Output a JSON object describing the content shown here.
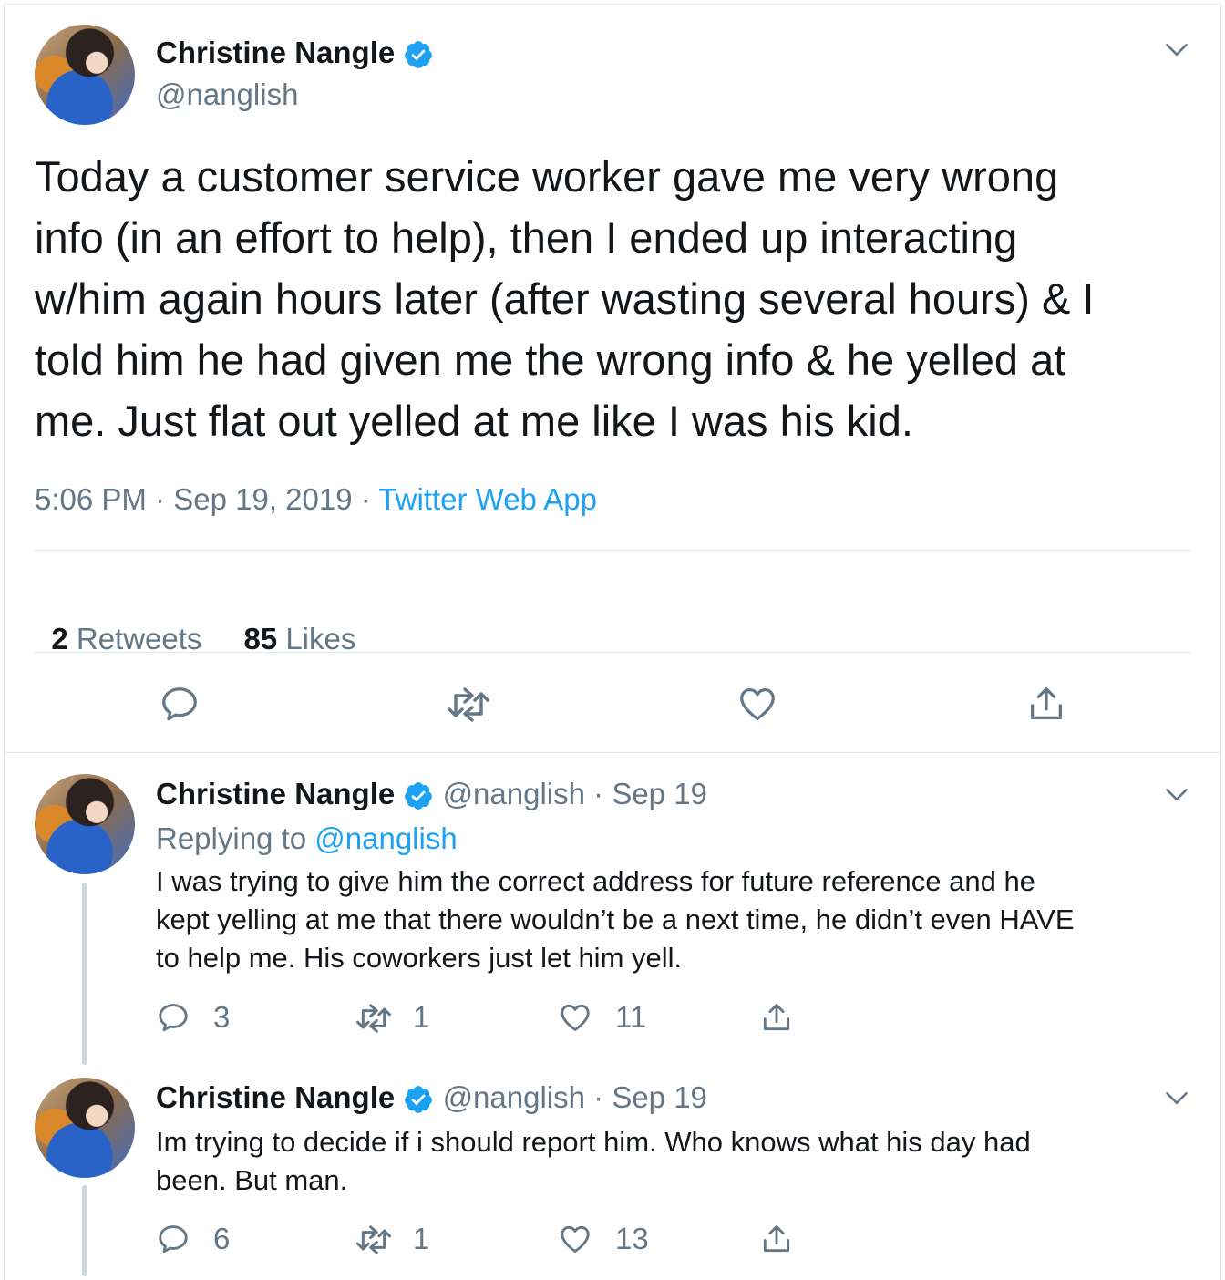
{
  "main_tweet": {
    "name": "Christine Nangle",
    "handle": "@nanglish",
    "text_lines": [
      "Today a customer service worker gave me very wrong",
      "info (in an effort to help), then I ended up interacting",
      "w/him again hours later (after wasting several hours) & I",
      "told him he had given me the wrong info & he yelled at",
      "me. Just flat out yelled at me like I was his kid."
    ],
    "time": "5:06 PM · Sep 19, 2019 · ",
    "source": "Twitter Web App",
    "retweets_count": "2",
    "retweets_label": " Retweets",
    "likes_count": "85",
    "likes_label": " Likes"
  },
  "replies": [
    {
      "name": "Christine Nangle",
      "handle_date": "@nanglish · Sep 19",
      "replying_prefix": "Replying to ",
      "replying_handle": "@nanglish",
      "text_lines": [
        "I was trying to give him the correct address for future reference and he",
        "kept yelling at me that there wouldn’t be a next time, he didn’t even HAVE",
        "to help me. His coworkers just let him yell."
      ],
      "reply_count": "3",
      "retweet_count": "1",
      "like_count": "11"
    },
    {
      "name": "Christine Nangle",
      "handle_date": "@nanglish · Sep 19",
      "text_lines": [
        "Im trying to decide if i should report him. Who knows what his day had",
        "been. But man."
      ],
      "reply_count": "6",
      "retweet_count": "1",
      "like_count": "13"
    }
  ],
  "colors": {
    "accent": "#1da1f2",
    "muted": "#657786",
    "text": "#14171a",
    "divider": "#e1e8ed"
  },
  "icons": [
    "verified-badge-icon",
    "chevron-down-icon",
    "reply-icon",
    "retweet-icon",
    "like-icon",
    "share-icon"
  ]
}
